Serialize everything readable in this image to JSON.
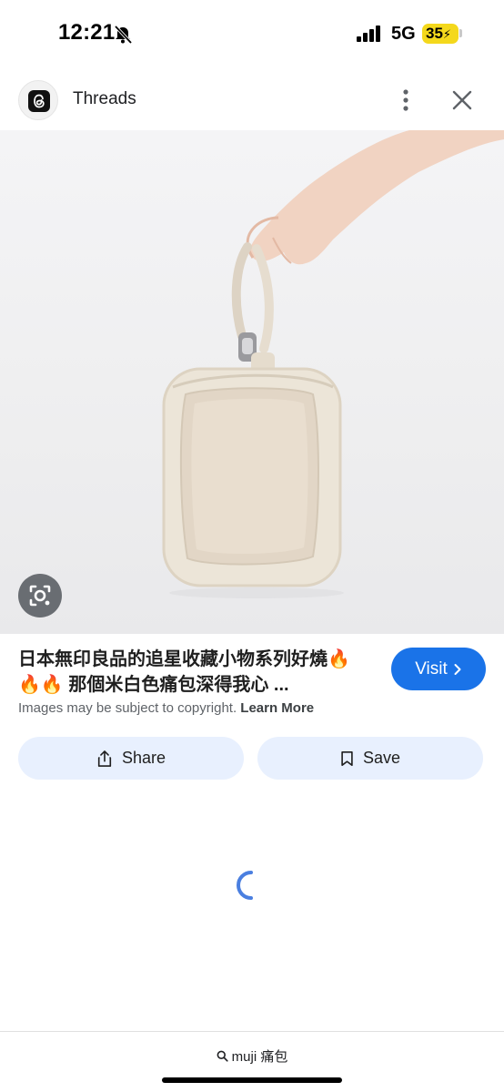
{
  "status_bar": {
    "time": "12:21",
    "network": "5G",
    "battery": "35"
  },
  "header": {
    "source_name": "Threads"
  },
  "result": {
    "title_line1": "日本無印良品的追星收藏小物系列好燒🔥",
    "title_line2": "🔥🔥 那個米白色痛包深得我心 ...",
    "visit_label": "Visit",
    "copyright_text": "Images may be subject to copyright.",
    "learn_more": "Learn More"
  },
  "actions": {
    "share_label": "Share",
    "save_label": "Save"
  },
  "search": {
    "query": "muji 痛包"
  },
  "colors": {
    "accent": "#1a73e8",
    "action_bg": "#e8f0fe",
    "battery": "#f4d81c"
  },
  "icons": [
    "bell-muted-icon",
    "signal-icon",
    "threads-logo",
    "more-vert-icon",
    "close-icon",
    "google-lens-icon",
    "chevron-right-icon",
    "share-icon",
    "bookmark-icon",
    "loading-spinner",
    "search-icon"
  ]
}
